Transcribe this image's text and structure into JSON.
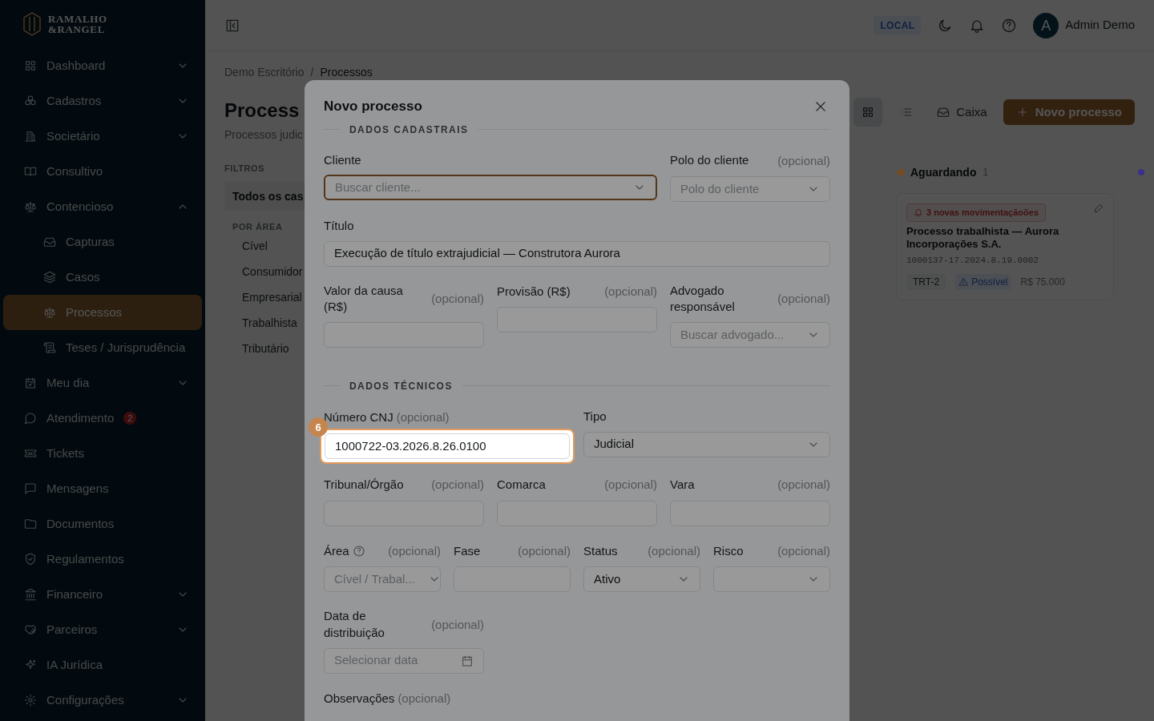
{
  "sidebar": {
    "logo": {
      "line1": "RAMALHO",
      "line2": "&RANGEL"
    },
    "items": [
      {
        "label": "Dashboard",
        "expandable": true,
        "expanded": false,
        "selected": false
      },
      {
        "label": "Cadastros",
        "expandable": true,
        "expanded": false,
        "selected": false
      },
      {
        "label": "Societário",
        "expandable": true,
        "expanded": false,
        "selected": false
      },
      {
        "label": "Consultivo",
        "expandable": false,
        "selected": false
      },
      {
        "label": "Contencioso",
        "expandable": true,
        "expanded": true,
        "selected": false,
        "children": [
          {
            "label": "Capturas",
            "selected": false
          },
          {
            "label": "Casos",
            "selected": false
          },
          {
            "label": "Processos",
            "selected": true
          },
          {
            "label": "Teses / Jurisprudência",
            "selected": false
          }
        ]
      },
      {
        "label": "Meu dia",
        "expandable": true,
        "expanded": false,
        "selected": false
      },
      {
        "label": "Atendimento",
        "expandable": false,
        "selected": false,
        "badge": "2"
      },
      {
        "label": "Tickets",
        "expandable": false,
        "selected": false
      },
      {
        "label": "Mensagens",
        "expandable": false,
        "selected": false
      },
      {
        "label": "Documentos",
        "expandable": false,
        "selected": false
      },
      {
        "label": "Regulamentos",
        "expandable": false,
        "selected": false
      },
      {
        "label": "Financeiro",
        "expandable": true,
        "expanded": false,
        "selected": false
      },
      {
        "label": "Parceiros",
        "expandable": true,
        "expanded": false,
        "selected": false
      },
      {
        "label": "IA Jurídica",
        "expandable": false,
        "selected": false
      },
      {
        "label": "Configurações",
        "expandable": true,
        "expanded": false,
        "selected": false
      }
    ]
  },
  "header": {
    "env_badge": "LOCAL",
    "user": {
      "initial": "A",
      "name": "Admin Demo"
    }
  },
  "page": {
    "breadcrumb": {
      "items": [
        "Demo Escritório",
        "Processos"
      ],
      "separator": "/"
    },
    "title": "Process",
    "subtitle": "Processos judic",
    "filters": {
      "heading": "FILTROS",
      "all": {
        "label": "Todos os cas",
        "selected": true
      },
      "group_heading": "POR ÁREA",
      "areas": [
        {
          "label": "Cível",
          "selected": false
        },
        {
          "label": "Consumidor",
          "selected": false
        },
        {
          "label": "Empresarial",
          "selected": false
        },
        {
          "label": "Trabalhista",
          "selected": false
        },
        {
          "label": "Tributário",
          "selected": false
        }
      ]
    },
    "views": [
      {
        "selected": true
      },
      {
        "selected": false
      }
    ],
    "inbox_button": "Caixa",
    "new_button": "Novo processo",
    "columns": [
      {
        "title": "Aguardando",
        "count": "1",
        "color": "#7a4a1f",
        "cards": [
          {
            "alert": "3 novas movimentaçãoões",
            "title": "Processo trabalhista — Aurora Incorporações S.A.",
            "number": "1000137-17.2024.8.19.0002",
            "court": "TRT-2",
            "risk": "Possível",
            "value": "R$ 75.000"
          }
        ]
      },
      {
        "color": "#3a2f8a"
      }
    ]
  },
  "modal": {
    "title": "Novo processo",
    "sections": [
      {
        "title": "DADOS CADASTRAIS",
        "fields": [
          {
            "label": "Cliente",
            "kind": "select",
            "placeholder": "Buscar cliente...",
            "focused": true
          },
          {
            "label": "Polo do cliente",
            "optional": "(opcional)",
            "kind": "select",
            "placeholder": "Polo do cliente"
          },
          {
            "label": "Título",
            "kind": "text",
            "value": "Execução de título extrajudicial — Construtora Aurora"
          },
          {
            "label": "Valor da causa (R$)",
            "optional": "(opcional)",
            "kind": "text"
          },
          {
            "label": "Provisão (R$)",
            "optional": "(opcional)",
            "kind": "text"
          },
          {
            "label": "Advogado responsável",
            "optional": "(opcional)",
            "kind": "select",
            "placeholder": "Buscar advogado..."
          }
        ]
      },
      {
        "title": "DADOS TÉCNICOS",
        "fields": [
          {
            "label": "Número CNJ",
            "optional": "(opcional)",
            "kind": "text",
            "value": "1000722-03.2026.8.26.0100",
            "highlight": {
              "step": "6"
            }
          },
          {
            "label": "Tipo",
            "kind": "select",
            "value": "Judicial"
          },
          {
            "label": "Tribunal/Órgão",
            "optional": "(opcional)",
            "kind": "text"
          },
          {
            "label": "Comarca",
            "optional": "(opcional)",
            "kind": "text"
          },
          {
            "label": "Vara",
            "optional": "(opcional)",
            "kind": "text"
          },
          {
            "label": "Área",
            "optional": "(opcional)",
            "help": true,
            "kind": "select",
            "placeholder": "Cível / Trabal..."
          },
          {
            "label": "Fase",
            "optional": "(opcional)",
            "kind": "text"
          },
          {
            "label": "Status",
            "optional": "(opcional)",
            "kind": "select",
            "value": "Ativo"
          },
          {
            "label": "Risco",
            "optional": "(opcional)",
            "kind": "select"
          },
          {
            "label": "Data de distribuição",
            "optional": "(opcional)",
            "kind": "date",
            "placeholder": "Selecionar data"
          },
          {
            "label": "Observações",
            "optional": "(opcional)",
            "kind": "label_only"
          }
        ]
      }
    ]
  }
}
